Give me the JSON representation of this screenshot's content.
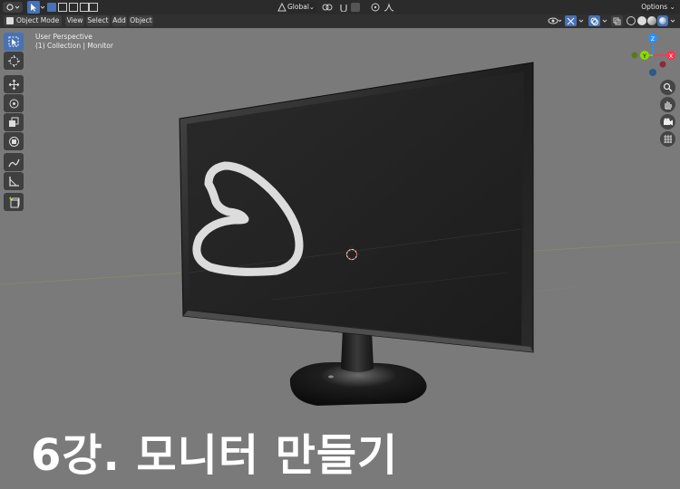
{
  "topbar": {
    "transform_orientation": "Global",
    "options_label": "Options"
  },
  "header": {
    "mode_label": "Object Mode",
    "menu": [
      "View",
      "Select",
      "Add",
      "Object"
    ]
  },
  "viewport": {
    "perspective_label": "User Perspective",
    "collection_label": "(1) Collection | Monitor",
    "gizmo": {
      "x": "X",
      "y": "Y",
      "z": "Z"
    }
  },
  "overlay": {
    "title": "6강. 모니터 만들기"
  },
  "colors": {
    "accent": "#4772b3",
    "x_axis": "#ff3352",
    "y_axis": "#8bdc00",
    "z_axis": "#2890ff",
    "viewport_bg": "#7a7a7a",
    "drawn_stroke": "#dcdcdc"
  },
  "tools": [
    "select-box-icon",
    "cursor-icon",
    "move-icon",
    "rotate-icon",
    "scale-icon",
    "transform-icon",
    "annotate-icon",
    "measure-icon",
    "add-cube-icon"
  ]
}
